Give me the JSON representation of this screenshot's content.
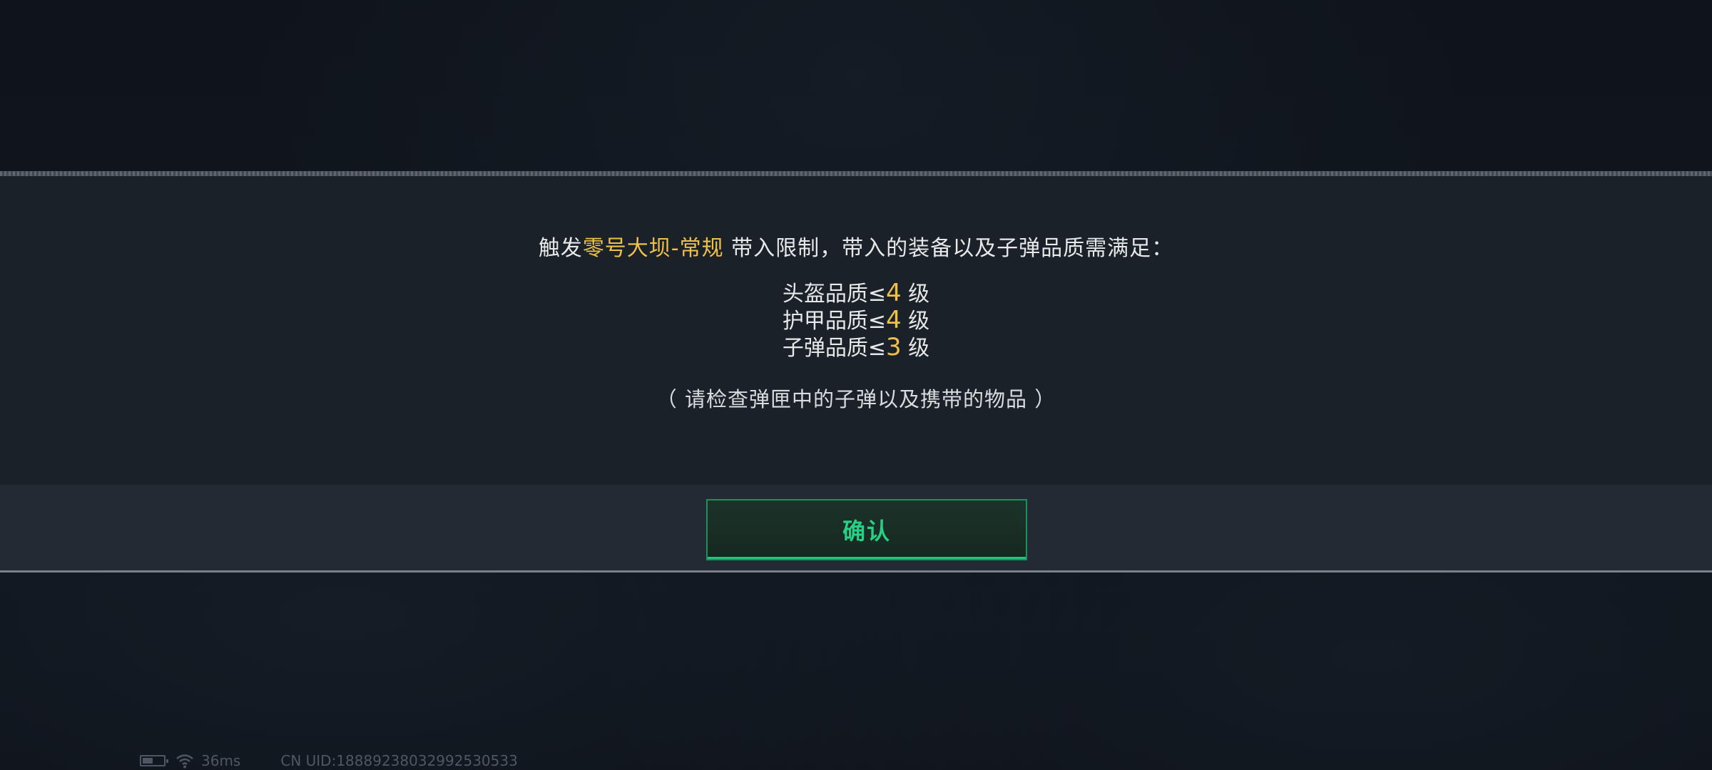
{
  "dialog": {
    "message": {
      "prefix": "触发",
      "map_name": "零号大坝-常规",
      "suffix": " 带入限制，带入的装备以及子弹品质需满足："
    },
    "requirements": [
      {
        "label": "头盔品质≤",
        "value": "4",
        "unit": " 级"
      },
      {
        "label": "护甲品质≤",
        "value": "4",
        "unit": " 级"
      },
      {
        "label": "子弹品质≤",
        "value": "3",
        "unit": " 级"
      }
    ],
    "hint": "（ 请检查弹匣中的子弹以及携带的物品 ）",
    "confirm_label": "确认"
  },
  "status": {
    "ping": "36ms",
    "uid": "CN UID:18889238032992530533"
  },
  "colors": {
    "highlight": "#f0c14a",
    "confirm_green": "#27d084",
    "dialog_bg": "#1b2129"
  }
}
